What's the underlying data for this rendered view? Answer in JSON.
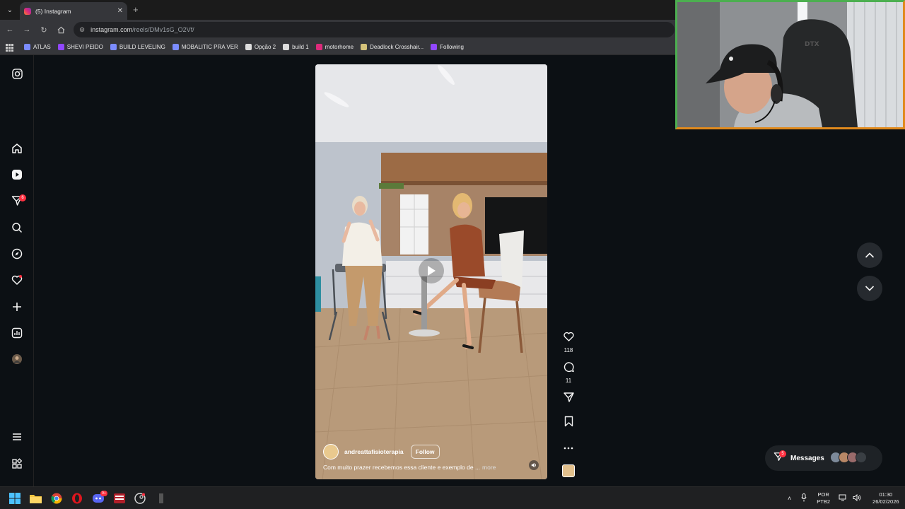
{
  "browser": {
    "tab_title": "(5) Instagram",
    "url_domain": "instagram.com",
    "url_path": "/reels/DMv1sG_O2Vf/",
    "bookmarks": [
      {
        "label": "ATLAS",
        "color": "#7b8cff"
      },
      {
        "label": "SHEVI PEIDO",
        "color": "#9147ff"
      },
      {
        "label": "BUILD LEVELING",
        "color": "#7b8cff"
      },
      {
        "label": "MOBALITIC PRA VER",
        "color": "#7b8cff"
      },
      {
        "label": "Opção 2",
        "color": "#dddddd"
      },
      {
        "label": "build 1",
        "color": "#dddddd"
      },
      {
        "label": "motorhome",
        "color": "#dd2a7b"
      },
      {
        "label": "Deadlock Crosshair...",
        "color": "#d4c27a"
      },
      {
        "label": "Following",
        "color": "#9147ff"
      }
    ]
  },
  "sidebar": {
    "notifications_badge": "6"
  },
  "reel": {
    "username": "andreattafisioterapia",
    "follow_label": "Follow",
    "caption": "Com muito prazer recebemos essa cliente e exemplo de ...",
    "more_label": "more",
    "likes": "118",
    "comments": "11"
  },
  "messages": {
    "label": "Messages",
    "badge": "5"
  },
  "taskbar": {
    "lang_top": "POR",
    "lang_bottom": "PTB2",
    "time": "01:30",
    "date": "26/02/2026",
    "discord_badge": "9+"
  },
  "colors": {
    "page_bg": "#0c1014",
    "badge_red": "#ff3040",
    "webcam_border": "#e08a1d"
  }
}
